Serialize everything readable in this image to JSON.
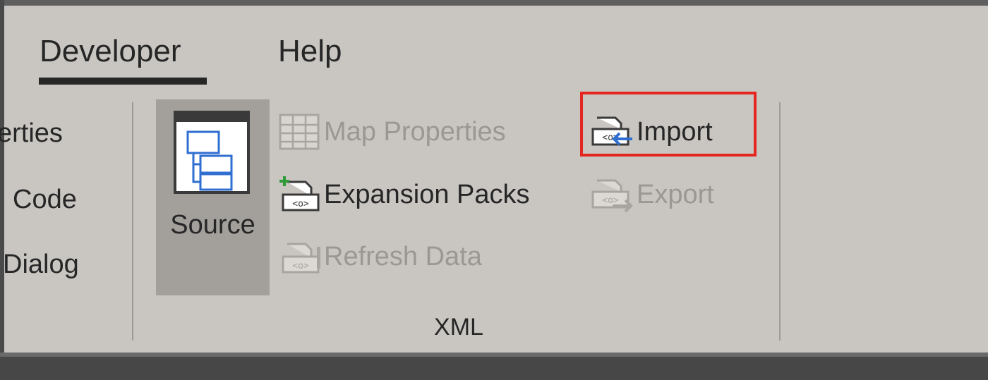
{
  "tabs": {
    "developer": "Developer",
    "help": "Help"
  },
  "left_group": {
    "properties": "erties",
    "view_code": "Code",
    "run_dialog": "Dialog"
  },
  "xml_group": {
    "source": "Source",
    "map_properties": "Map Properties",
    "expansion_packs": "Expansion Packs",
    "refresh_data": "Refresh Data",
    "import": "Import",
    "export": "Export",
    "group_label": "XML"
  },
  "colors": {
    "highlight": "#e52521",
    "ribbon_bg": "#c9c6c2",
    "source_bg": "#a3a09c",
    "arrow": "#2f6fd1",
    "plus": "#2e9b3a"
  },
  "icons": [
    "source-tree-icon",
    "map-properties-icon",
    "expansion-packs-icon",
    "refresh-data-icon",
    "import-icon",
    "export-icon"
  ]
}
